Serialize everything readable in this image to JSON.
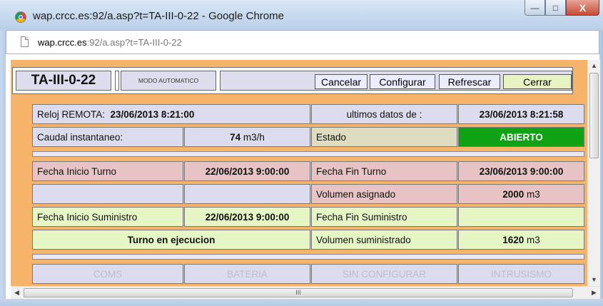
{
  "window": {
    "title": "wap.crcc.es:92/a.asp?t=TA-III-0-22 - Google Chrome",
    "minimize_glyph": "—",
    "maximize_glyph": "□",
    "close_glyph": "X"
  },
  "address": {
    "host": "wap.crcc.es",
    "rest": ":92/a.asp?t=TA-III-0-22"
  },
  "header": {
    "remote_id": "TA-III-0-22",
    "mode": "MODO AUTOMATICO",
    "buttons": {
      "cancel": "Cancelar",
      "configure": "Configurar",
      "refresh": "Refrescar",
      "close": "Cerrar"
    }
  },
  "info": {
    "clock_label": "Reloj REMOTA:",
    "clock_value": "23/06/2013 8:21:00",
    "last_data_label": "ultimos datos de :",
    "last_data_value": "23/06/2013 8:21:58",
    "flow_label": "Caudal instantaneo:",
    "flow_value": "74",
    "flow_unit": "m3/h",
    "state_label": "Estado",
    "state_value": "ABIERTO"
  },
  "turno": {
    "start_label": "Fecha Inicio Turno",
    "start_value": "22/06/2013 9:00:00",
    "end_label": "Fecha Fin Turno",
    "end_value": "23/06/2013 9:00:00",
    "volume_assigned_label": "Volumen asignado",
    "volume_assigned_value": "2000",
    "volume_assigned_unit": "m3",
    "supply_start_label": "Fecha Inicio Suministro",
    "supply_start_value": "22/06/2013 9:00:00",
    "supply_end_label": "Fecha Fin Suministro",
    "status_text": "Turno en ejecucion",
    "volume_supplied_label": "Volumen suministrado",
    "volume_supplied_value": "1620",
    "volume_supplied_unit": "m3"
  },
  "status_row": [
    "COMS",
    "BATERIA",
    "SIN CONFIGURAR",
    "INTRUSISMO"
  ],
  "scrollbars": {
    "up": "▲",
    "down": "▼",
    "left": "◀",
    "right": "▶",
    "grip": "III"
  }
}
